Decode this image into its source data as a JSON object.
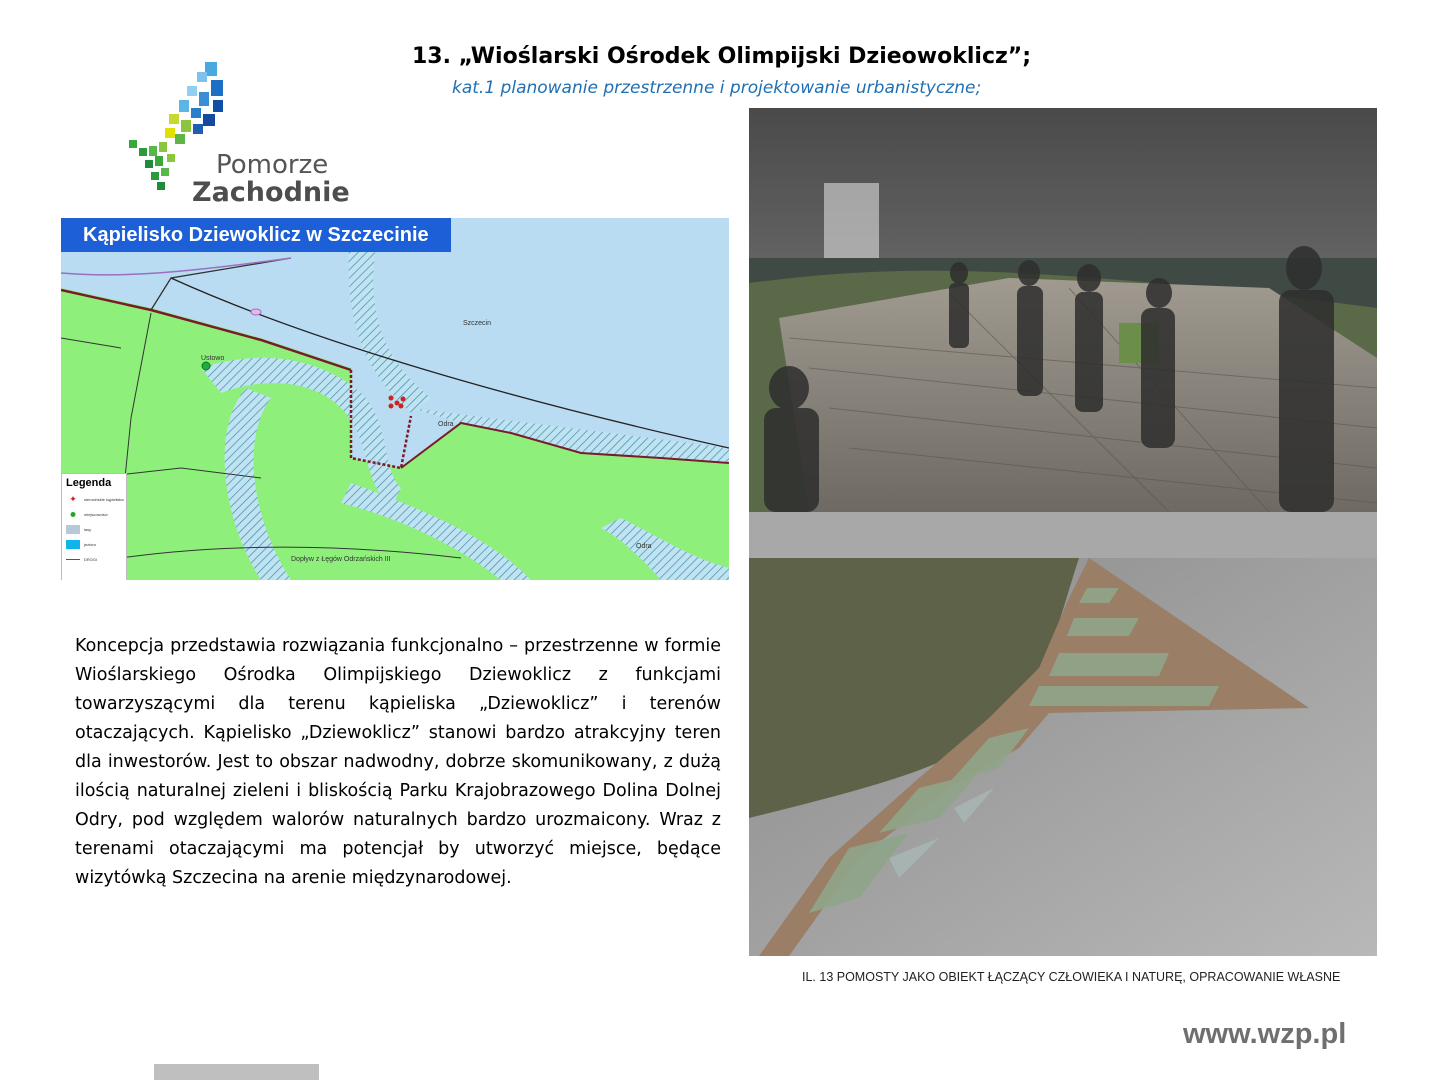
{
  "header": {
    "title": "13.   „Wioślarski Ośrodek Olimpijski Dzieowoklicz”;",
    "subtitle": "kat.1 planowanie przestrzenne i projektowanie urbanistyczne;"
  },
  "logo": {
    "line1": "Pomorze",
    "line2": "Zachodnie"
  },
  "map": {
    "title": "Kąpielisko Dziewoklicz w Szczecinie",
    "labels": {
      "szczecin": "Szczecin",
      "ustowo": "Ustowo",
      "odra1": "Odra",
      "odra2": "Odra",
      "doplyw": "Dopływ z Łęgów Odrzańskich III"
    },
    "legend": {
      "title": "Legenda",
      "items": [
        {
          "label": "sierocińskie kąpieliska",
          "color": "#cc2222"
        },
        {
          "label": "miejscowości",
          "color": "#22aa22"
        },
        {
          "label": "lasy",
          "color": "#b8c8d8"
        },
        {
          "label": "jeziora",
          "color": "#0fb4ea"
        },
        {
          "label": "DROGI",
          "color": "#555555"
        }
      ]
    }
  },
  "body_text": "Koncepcja przedstawia rozwiązania funkcjonalno – przestrzenne w formie Wioślarskiego Ośrodka Olimpijskiego Dziewoklicz z funkcjami towarzyszącymi dla terenu kąpieliska „Dziewoklicz” i terenów otaczających. Kąpielisko „Dziewoklicz” stanowi bardzo atrakcyjny teren dla inwestorów. Jest to obszar nadwodny, dobrze skomunikowany, z dużą ilością naturalnej zieleni i bliskością Parku Krajobrazowego Dolina Dolnej Odry, pod względem walorów naturalnych bardzo urozmaicony. Wraz z terenami otaczającymi ma potencjał by utworzyć miejsce, będące wizytówką Szczecina na arenie międzynarodowej.",
  "caption": "IL. 13 POMOSTY JAKO OBIEKT ŁĄCZĄCY CZŁOWIEKA I NATURĘ, OPRACOWANIE WŁASNE",
  "website": "www.wzp.pl"
}
